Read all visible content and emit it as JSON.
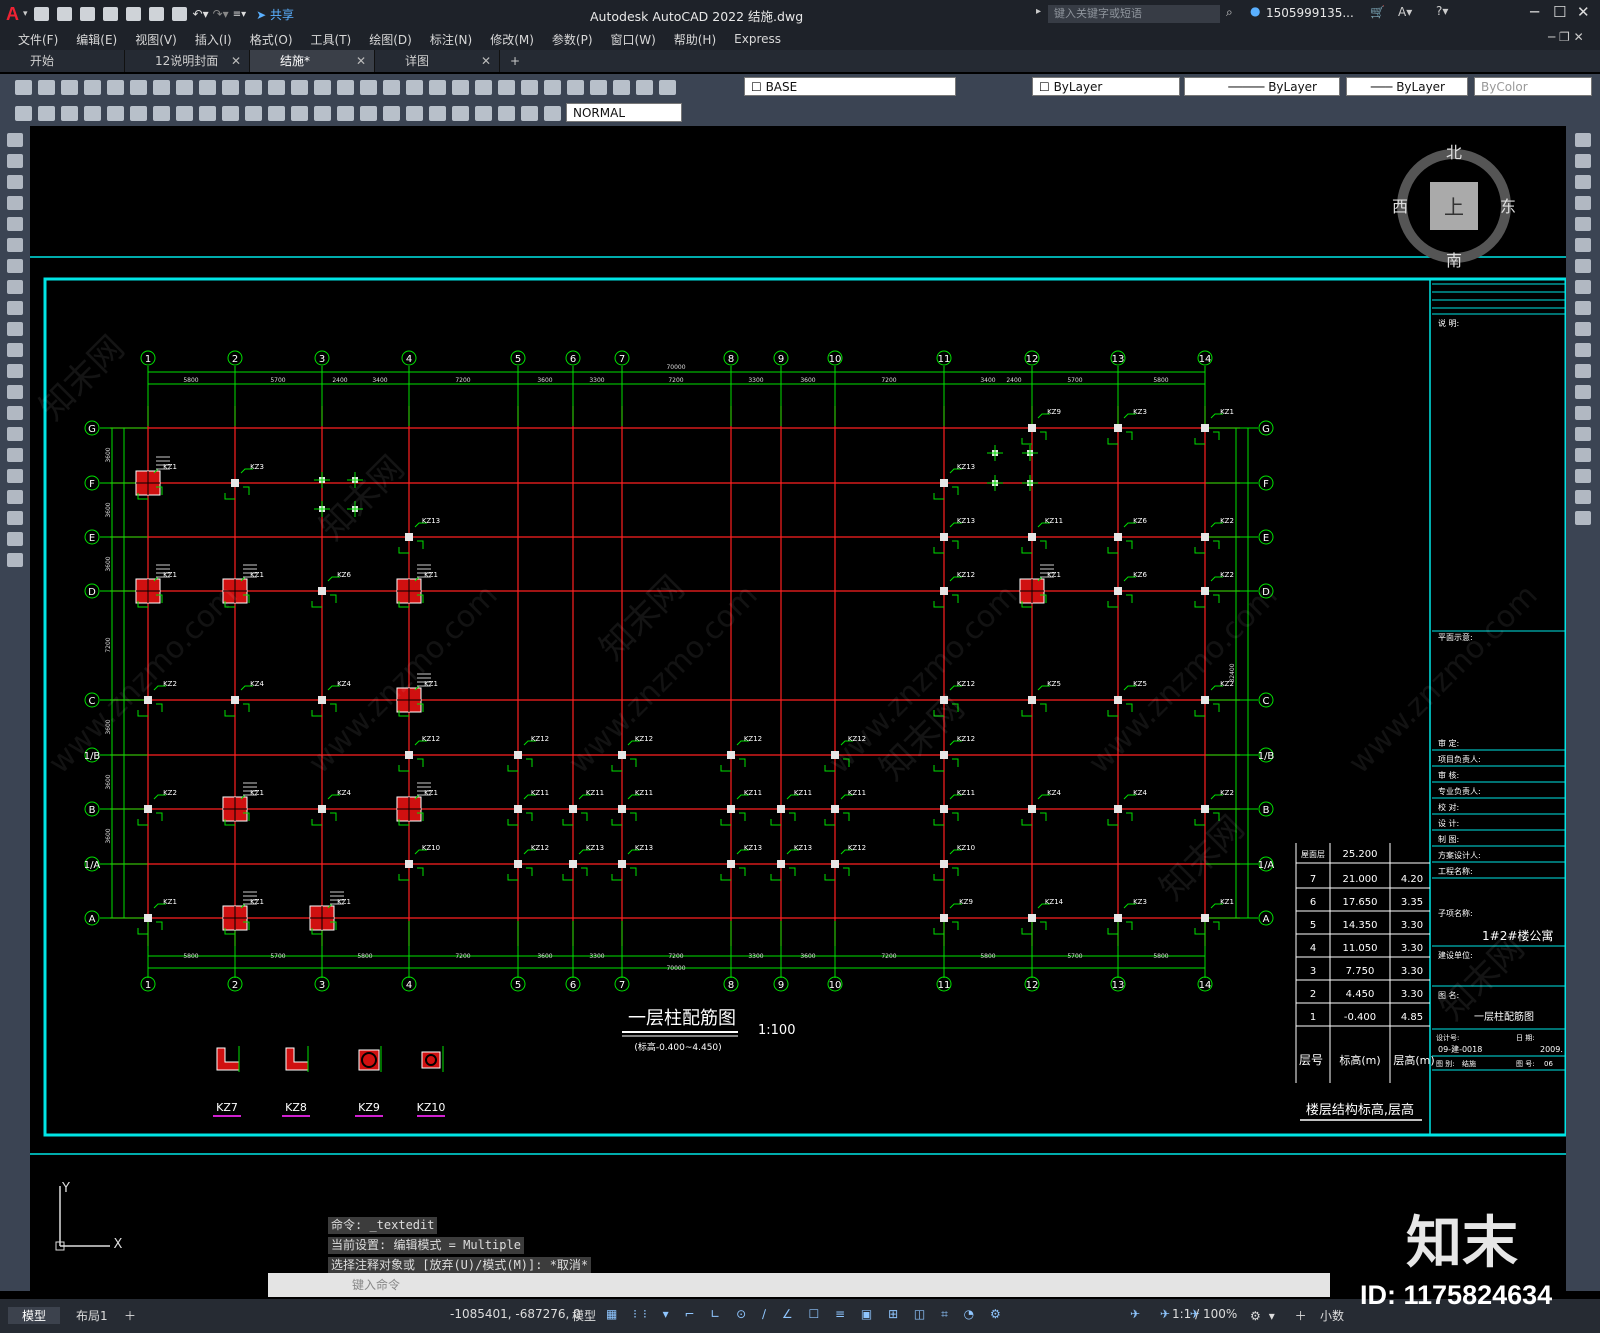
{
  "app": {
    "title": "Autodesk AutoCAD 2022    结施.dwg",
    "share_label": "共享",
    "search_placeholder": "键入关键字或短语",
    "user": "1505999135...",
    "logo": "A"
  },
  "menu": [
    "文件(F)",
    "编辑(E)",
    "视图(V)",
    "插入(I)",
    "格式(O)",
    "工具(T)",
    "绘图(D)",
    "标注(N)",
    "修改(M)",
    "参数(P)",
    "窗口(W)",
    "帮助(H)",
    "Express"
  ],
  "tabs": [
    {
      "label": "开始",
      "closable": false
    },
    {
      "label": "12说明封面",
      "closable": true
    },
    {
      "label": "结施*",
      "closable": true,
      "active": true
    },
    {
      "label": "详图",
      "closable": true
    }
  ],
  "toolbar": {
    "layer_value": "BASE",
    "color_value": "ByLayer",
    "linetype_value": "ByLayer",
    "lineweight_value": "ByLayer",
    "plotstyle_value": "ByColor",
    "dimstyle_value": "NORMAL"
  },
  "viewcube": {
    "north": "北",
    "south": "南",
    "east": "东",
    "west": "西",
    "top": "上"
  },
  "drawing": {
    "title": "一层柱配筋图",
    "scale": "1:100",
    "subtitle": "(标高-0.400~4.450)",
    "top_axes": [
      "1",
      "2",
      "3",
      "4",
      "5",
      "6",
      "7",
      "8",
      "9",
      "10",
      "11",
      "12",
      "13",
      "14"
    ],
    "side_axes": [
      "G",
      "F",
      "E",
      "D",
      "C",
      "1/B",
      "B",
      "1/A",
      "A"
    ],
    "top_spans": [
      "5800",
      "5700",
      "2400",
      "3400",
      "7200",
      "3600",
      "3300",
      "7200",
      "3300",
      "3600",
      "7200",
      "3400",
      "2400",
      "5700",
      "5800"
    ],
    "total_length": "70000",
    "bottom_spans": [
      "5800",
      "5700",
      "5800",
      "7200",
      "3600",
      "3300",
      "7200",
      "3300",
      "3600",
      "7200",
      "5800",
      "5700",
      "5800"
    ],
    "left_spans": [
      "3600",
      "3600",
      "3600",
      "7200",
      "3600",
      "3600",
      "3600"
    ],
    "total_height": "32400",
    "column_labels": [
      "KZ1",
      "KZ2",
      "KZ3",
      "KZ4",
      "KZ5",
      "KZ6",
      "KZ7",
      "KZ8",
      "KZ9",
      "KZ10",
      "KZ11",
      "KZ12",
      "KZ13",
      "KZ14"
    ],
    "detail_labels": [
      "KZ7",
      "KZ8",
      "KZ9",
      "KZ10"
    ]
  },
  "floor_table": {
    "title": "楼层结构标高,层高",
    "roof_label": "屋面层",
    "roof_elev": "25.200",
    "rows": [
      {
        "floor": "7",
        "elev": "21.000",
        "height": "4.20"
      },
      {
        "floor": "6",
        "elev": "17.650",
        "height": "3.35"
      },
      {
        "floor": "5",
        "elev": "14.350",
        "height": "3.30"
      },
      {
        "floor": "4",
        "elev": "11.050",
        "height": "3.30"
      },
      {
        "floor": "3",
        "elev": "7.750",
        "height": "3.30"
      },
      {
        "floor": "2",
        "elev": "4.450",
        "height": "3.30"
      },
      {
        "floor": "1",
        "elev": "-0.400",
        "height": "4.85"
      }
    ],
    "col_floor": "层号",
    "col_elev": "标高(m)",
    "col_height": "层高(m)"
  },
  "title_block": {
    "rows": [
      "审 定:",
      "项目负责人:",
      "审 核:",
      "专业负责人:",
      "校 对:",
      "设 计:",
      "制 图:",
      "方案设计人:",
      "工程名称:"
    ],
    "sub_item_label": "子项名称:",
    "sub_item": "1#2#楼公寓",
    "owner_label": "建设单位:",
    "drawing_name_label": "图 名:",
    "drawing_name": "一层柱配筋图",
    "design_no": "设计号:",
    "design_no_value": "09-建-0018",
    "date_label": "日 期:",
    "date_value": "2009.",
    "sheet_label": "图 别:",
    "sheet_value": "结施",
    "sheet_no_label": "图 号:",
    "sheet_no_value": "06",
    "notes_label": "说 明:",
    "plan_label": "平面示意:"
  },
  "command": {
    "history": [
      "命令: _textedit",
      "当前设置: 编辑模式 = Multiple",
      "选择注释对象或 [放弃(U)/模式(M)]: *取消*"
    ],
    "placeholder": "键入命令"
  },
  "status": {
    "coords": "-1085401, -687276, 0",
    "model_btn": "模型",
    "layout_tabs": [
      "模型",
      "布局1"
    ],
    "scale": "1:1 / 100%",
    "units": "小数"
  },
  "watermark": {
    "brand": "知末",
    "id": "ID: 1175824634",
    "url": "www.znzmo.com",
    "cn": "知末网"
  },
  "colors": {
    "grid": "#ff2020",
    "axis": "#00e000",
    "border": "#00e5e5",
    "column": "#e6e6e6"
  }
}
